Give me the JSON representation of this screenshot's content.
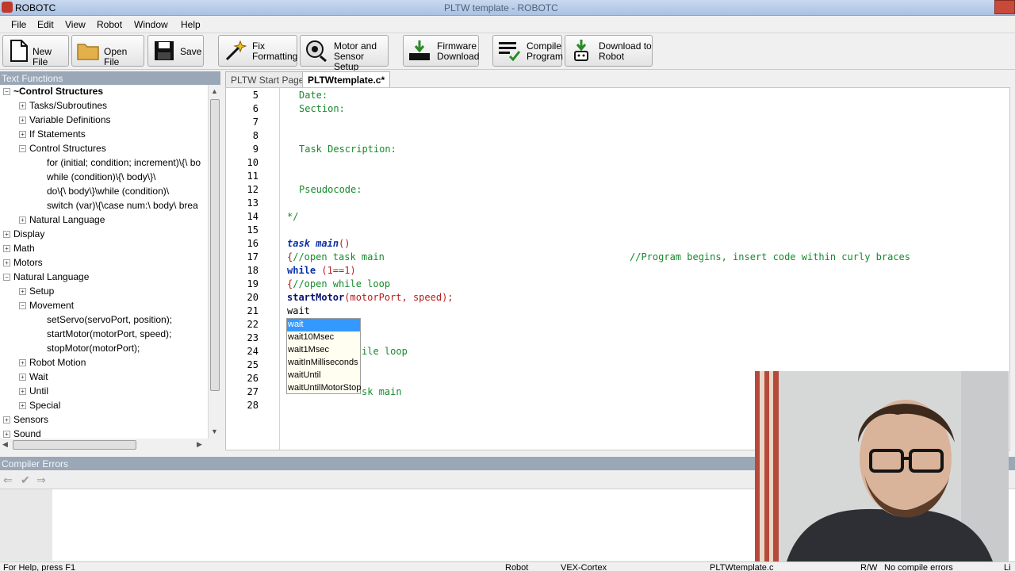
{
  "app": {
    "title": "ROBOTC",
    "document_title": "PLTW template - ROBOTC"
  },
  "menu": [
    "File",
    "Edit",
    "View",
    "Robot",
    "Window",
    "Help"
  ],
  "toolbar": {
    "new_file": "New File",
    "open_file": "Open File",
    "save": "Save",
    "fix_formatting": [
      "Fix",
      "Formatting"
    ],
    "motor_sensor": [
      "Motor and",
      "Sensor Setup"
    ],
    "firmware": [
      "Firmware",
      "Download"
    ],
    "compile": [
      "Compile",
      "Program"
    ],
    "download": [
      "Download to",
      "Robot"
    ]
  },
  "left_panel": {
    "header": "Text Functions",
    "tree": [
      {
        "label": "~Control Structures",
        "expander": "−",
        "bold": true
      },
      {
        "label": "Tasks/Subroutines",
        "expander": "+"
      },
      {
        "label": "Variable Definitions",
        "expander": "+"
      },
      {
        "label": "If Statements",
        "expander": "+"
      },
      {
        "label": "Control Structures",
        "expander": "−"
      },
      {
        "label": "for (initial; condition; increment)\\{\\  bo",
        "expander": ""
      },
      {
        "label": "while (condition)\\{\\  body\\}\\",
        "expander": ""
      },
      {
        "label": "do\\{\\  body\\}\\while (condition)\\",
        "expander": ""
      },
      {
        "label": "switch (var)\\{\\case num:\\  body\\  brea",
        "expander": ""
      },
      {
        "label": "Natural Language",
        "expander": "+"
      },
      {
        "label": "Display",
        "expander": "+"
      },
      {
        "label": "Math",
        "expander": "+"
      },
      {
        "label": "Motors",
        "expander": "+"
      },
      {
        "label": "Natural Language",
        "expander": "−"
      },
      {
        "label": "Setup",
        "expander": "+"
      },
      {
        "label": "Movement",
        "expander": "−"
      },
      {
        "label": "setServo(servoPort, position);",
        "expander": ""
      },
      {
        "label": "startMotor(motorPort, speed);",
        "expander": ""
      },
      {
        "label": "stopMotor(motorPort);",
        "expander": ""
      },
      {
        "label": "Robot Motion",
        "expander": "+"
      },
      {
        "label": "Wait",
        "expander": "+"
      },
      {
        "label": "Until",
        "expander": "+"
      },
      {
        "label": "Special",
        "expander": "+"
      },
      {
        "label": "Sensors",
        "expander": "+"
      },
      {
        "label": "Sound",
        "expander": "+"
      }
    ]
  },
  "tabs": [
    "PLTW Start Page",
    "PLTWtemplate.c*"
  ],
  "editor": {
    "line_numbers": [
      "5",
      "6",
      "7",
      "8",
      "9",
      "10",
      "11",
      "12",
      "13",
      "14",
      "15",
      "16",
      "17",
      "18",
      "19",
      "20",
      "21",
      "22",
      "23",
      "24",
      "25",
      "26",
      "27",
      "28"
    ],
    "lines": {
      "l5": "Date:",
      "l6": "Section:",
      "l9": "Task Description:",
      "l12": "Pseudocode:",
      "l14": "*/",
      "l16_kw1": "task",
      "l16_kw2": "main",
      "l16_rest": "()",
      "l17_brace": "{",
      "l17_cm": "//open task main",
      "l17_cm2": "//Program begins, insert code within curly braces",
      "l18_kw": "while",
      "l18_open": " (",
      "l18_num": "1==1",
      "l18_close": ")",
      "l19_brace": "{",
      "l19_cm": "//open while loop",
      "l20_fn": "startMotor",
      "l20_rest": "(motorPort, speed);",
      "l21": "wait",
      "l24_tail": "ile loop",
      "l27_tail": "sk main"
    }
  },
  "autocomplete": [
    "wait",
    "wait10Msec",
    "wait1Msec",
    "waitInMilliseconds",
    "waitUntil",
    "waitUntilMotorStop"
  ],
  "compiler": {
    "header": "Compiler Errors"
  },
  "status": {
    "help": "For Help, press F1",
    "robot": "Robot",
    "platform": "VEX-Cortex",
    "file": "PLTWtemplate.c",
    "mode": "R/W",
    "errors": "No compile errors",
    "extra": "Li"
  },
  "colors": {
    "keyword": "#0b30a8",
    "comment": "#168a2b",
    "number": "#b81b1b",
    "panel_header": "#9aa7b7",
    "selection": "#3399ff"
  }
}
